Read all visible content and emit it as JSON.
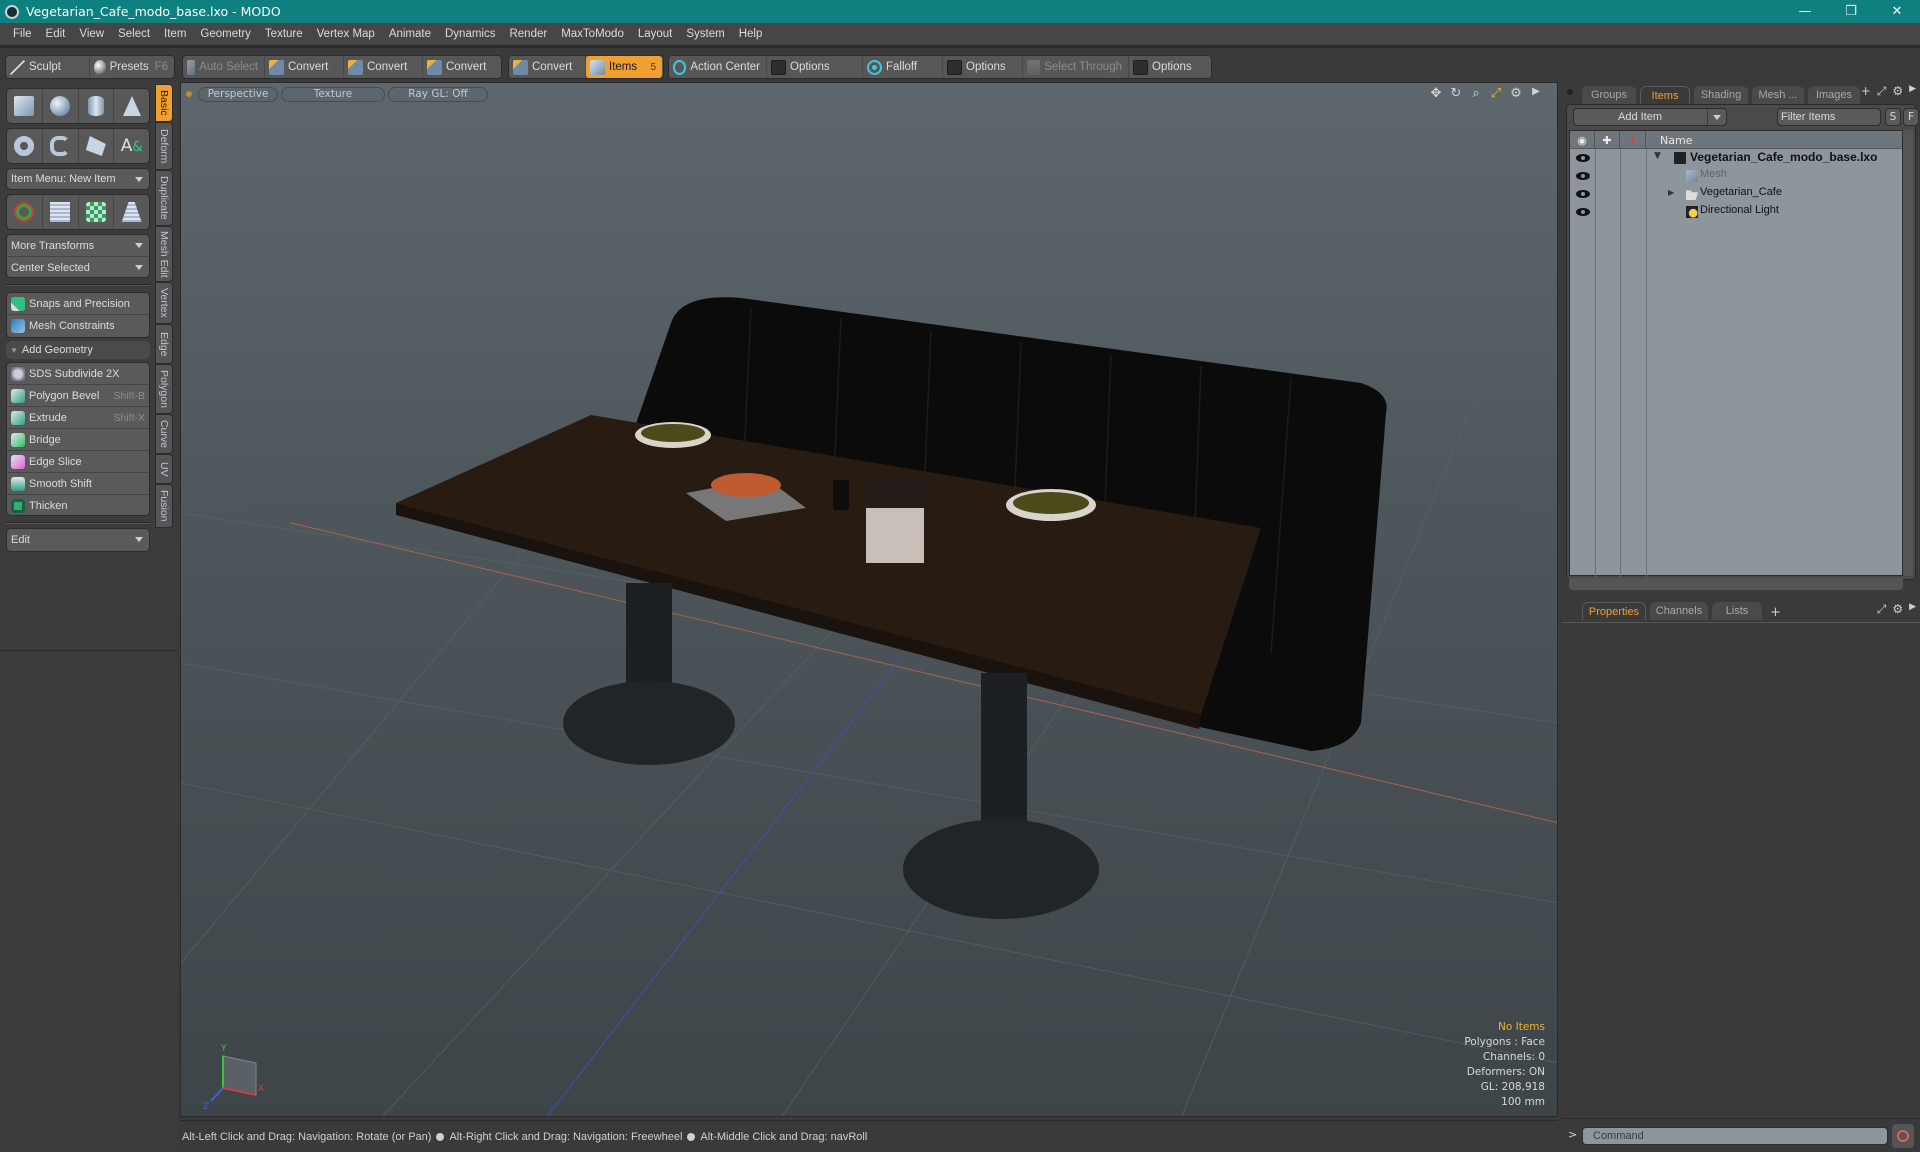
{
  "window": {
    "title": "Vegetarian_Cafe_modo_base.lxo - MODO",
    "controls": {
      "minimize": "—",
      "restore": "❐",
      "close": "✕"
    }
  },
  "menubar": [
    "File",
    "Edit",
    "View",
    "Select",
    "Item",
    "Geometry",
    "Texture",
    "Vertex Map",
    "Animate",
    "Dynamics",
    "Render",
    "MaxToModo",
    "Layout",
    "System",
    "Help"
  ],
  "toolbar": {
    "sculpt": "Sculpt",
    "presets": "Presets",
    "presets_shortcut": "F6",
    "auto_select": "Auto Select",
    "convert_1": "Convert",
    "convert_2": "Convert",
    "convert_3": "Convert",
    "convert_4": "Convert",
    "items": "Items",
    "items_count": "5",
    "action_center": "Action Center",
    "options_1": "Options",
    "falloff": "Falloff",
    "options_2": "Options",
    "select_through": "Select Through",
    "options_3": "Options"
  },
  "left_panel": {
    "item_menu": "Item Menu: New Item",
    "more_transforms": "More Transforms",
    "center_selected": "Center Selected",
    "snaps": "Snaps and Precision",
    "mesh_constraints": "Mesh Constraints",
    "add_geometry": "Add Geometry",
    "tools": [
      {
        "label": "SDS Subdivide 2X",
        "shortcut": ""
      },
      {
        "label": "Polygon Bevel",
        "shortcut": "Shift-B"
      },
      {
        "label": "Extrude",
        "shortcut": "Shift-X"
      },
      {
        "label": "Bridge",
        "shortcut": ""
      },
      {
        "label": "Edge Slice",
        "shortcut": ""
      },
      {
        "label": "Smooth Shift",
        "shortcut": ""
      },
      {
        "label": "Thicken",
        "shortcut": ""
      }
    ],
    "edit_dropdown": "Edit",
    "vertical_tabs": [
      "Basic",
      "Deform",
      "Duplicate",
      "Mesh Edit",
      "Vertex",
      "Edge",
      "Polygon",
      "Curve",
      "UV",
      "Fusion"
    ],
    "active_tab": "Basic"
  },
  "viewport": {
    "view_mode": "Perspective",
    "shading": "Texture",
    "raygl": "Ray GL: Off",
    "hud": {
      "selection": "No Items",
      "polygons": "Polygons : Face",
      "channels": "Channels: 0",
      "deformers": "Deformers: ON",
      "gl": "GL: 208,918",
      "scale": "100 mm"
    },
    "axis_labels": {
      "x": "X",
      "y": "Y",
      "z": "Z"
    }
  },
  "statusbar": {
    "hint_1": "Alt-Left Click and Drag: Navigation: Rotate (or Pan)",
    "hint_2": "Alt-Right Click and Drag: Navigation: Freewheel",
    "hint_3": "Alt-Middle Click and Drag: navRoll"
  },
  "right_panel": {
    "tabs": [
      "Groups",
      "Items",
      "Shading",
      "Mesh ...",
      "Images"
    ],
    "active_tab": "Items",
    "add_item": "Add Item",
    "filter_placeholder": "Filter Items",
    "s_btn": "S",
    "f_btn": "F",
    "name_header": "Name",
    "tree": [
      {
        "label": "Vegetarian_Cafe_modo_base.lxo",
        "type": "scene",
        "level": 0
      },
      {
        "label": "Mesh",
        "type": "mesh",
        "level": 1
      },
      {
        "label": "Vegetarian_Cafe",
        "type": "group",
        "level": 1
      },
      {
        "label": "Directional Light",
        "type": "light",
        "level": 1
      }
    ],
    "props_tabs": [
      "Properties",
      "Channels",
      "Lists"
    ],
    "props_active": "Properties",
    "command_placeholder": "Command",
    "prompt": ">"
  }
}
